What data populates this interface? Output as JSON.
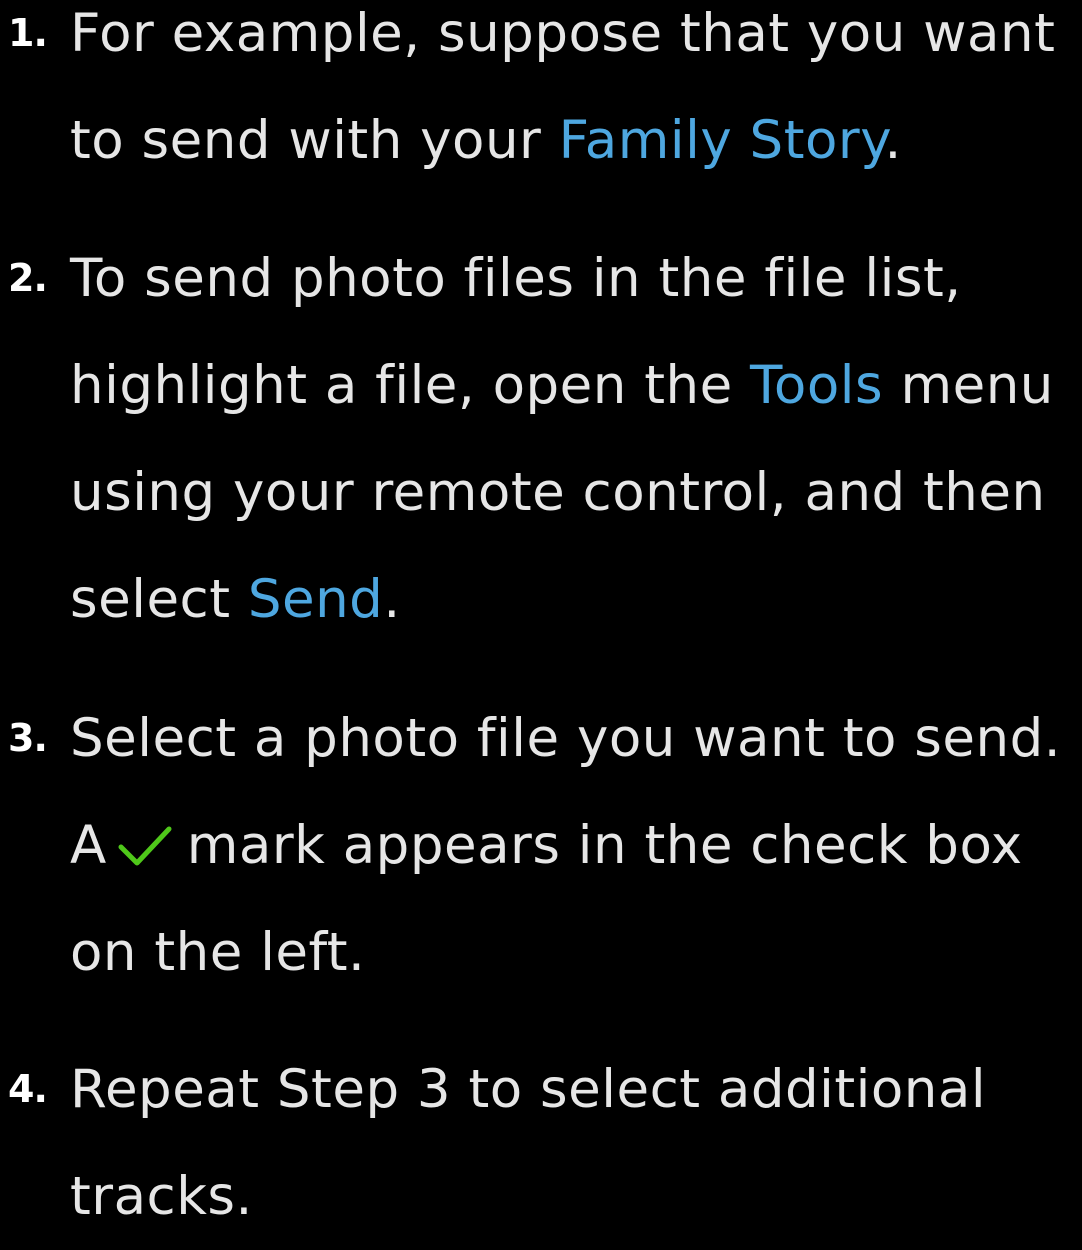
{
  "colors": {
    "background": "#000000",
    "text": "#e6e6e6",
    "highlight": "#4ea7e0",
    "check": "#4fc81a"
  },
  "steps": [
    {
      "number": "1.",
      "line1": "For example, suppose that you want",
      "line2_pre": "to send with your ",
      "line2_link": "Family Story",
      "line2_post": "."
    },
    {
      "number": "2.",
      "line1": "To send photo files in the file list,",
      "line2_pre": "highlight a file, open the ",
      "line2_link": "Tools",
      "line2_post": " menu",
      "line3": "using your remote control, and then",
      "line4_pre": "select ",
      "line4_link": "Send",
      "line4_post": "."
    },
    {
      "number": "3.",
      "line1": "Select a photo file you want to send.",
      "line2_pre": "A",
      "line2_icon": "checkmark-icon",
      "line2_post": "mark appears in the check box",
      "line3": "on the left."
    },
    {
      "number": "4.",
      "line1": "Repeat Step 3 to select additional",
      "line2": "tracks."
    }
  ]
}
